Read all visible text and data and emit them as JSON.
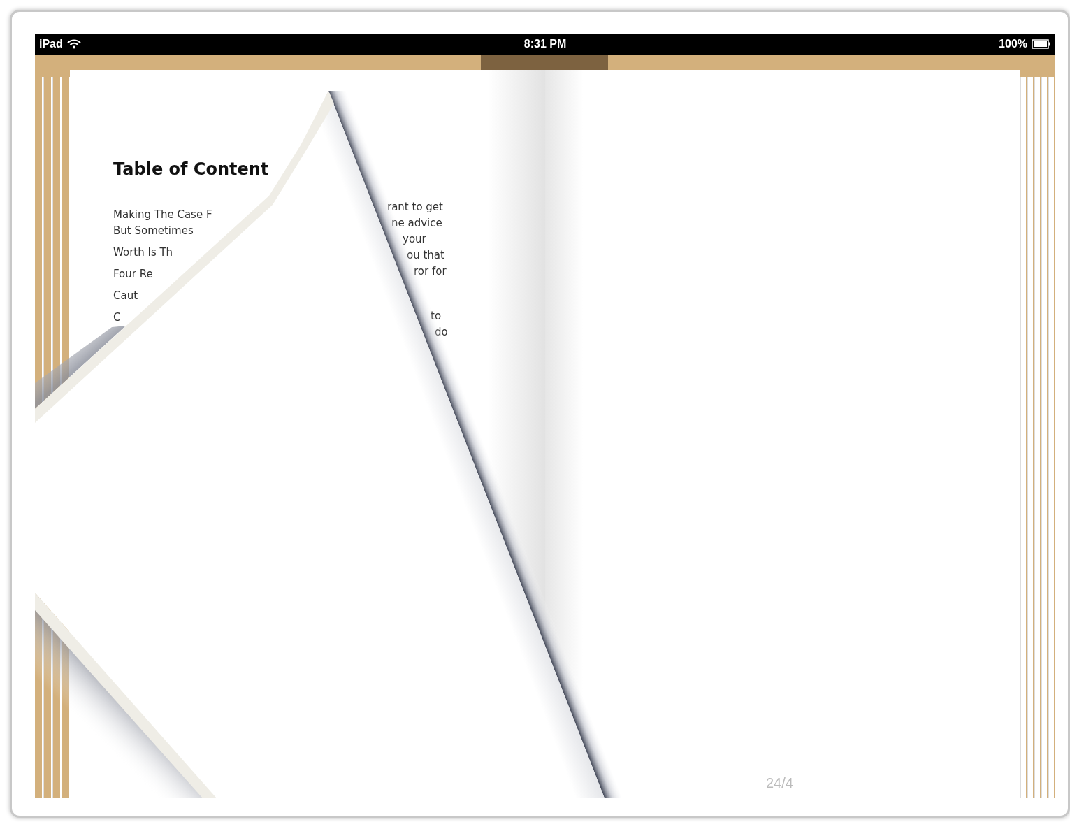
{
  "status_bar": {
    "device": "iPad",
    "time": "8:31 PM",
    "battery": "100%"
  },
  "left_page": {
    "heading": "Table of Content",
    "toc": [
      {
        "lines": [
          "Making The Case F",
          "But Sometimes"
        ]
      },
      {
        "lines": [
          "Worth Is Th"
        ]
      },
      {
        "lines": [
          "Four Re"
        ]
      },
      {
        "lines": [
          "Caut"
        ]
      },
      {
        "lines": [
          "C"
        ]
      }
    ]
  },
  "revealed_page": {
    "paragraphs": [
      {
        "lines": [
          "rant to get",
          "ne advice",
          "your",
          "ou that",
          "ror for"
        ]
      },
      {
        "lines": [
          "to",
          "do"
        ]
      }
    ]
  },
  "right_page": {
    "page_number": "24/4"
  }
}
